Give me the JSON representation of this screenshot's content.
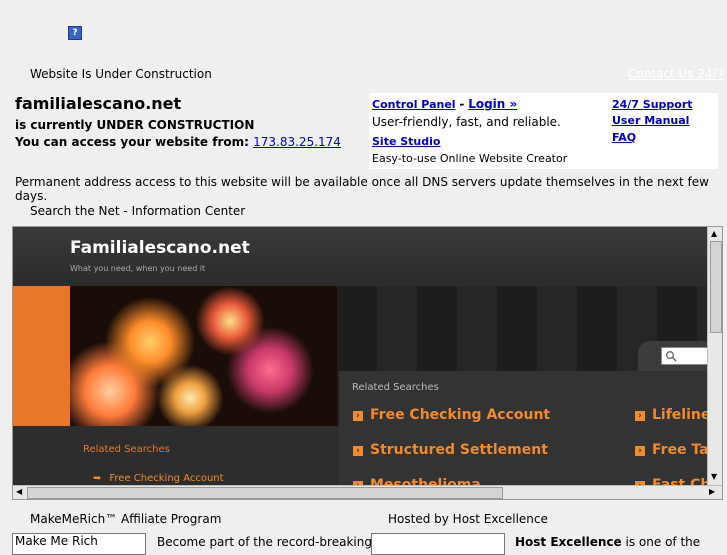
{
  "top": {
    "help_icon": "?",
    "under_construction": "Website Is Under Construction",
    "contact_link": "Contact Us 24/7"
  },
  "intro": {
    "domain": "familialescano.net",
    "line1": "is currently UNDER CONSTRUCTION",
    "line2_prefix": "You can access your website from:",
    "ip_link": "173.83.25.174"
  },
  "panel": {
    "control_panel": "Control Panel",
    "dash": "-",
    "login": "Login »",
    "tagline1": "User-friendly, fast, and reliable.",
    "site_studio": "Site Studio",
    "tagline2": "Easy-to-use Online Website Creator",
    "support": "24/7 Support",
    "manual": "User Manual",
    "faq": "FAQ"
  },
  "permanent_note": "Permanent address access to this website will be available once all DNS servers update themselves in the next few days.",
  "search_label": "Search the Net - Information Center",
  "frame": {
    "site_title": "Familialescano.net",
    "tagline": "What you need, when you need it",
    "related_header": "Related Searches",
    "related_items": [
      "Free Checking Account",
      "Structured Settlement",
      "Mesothelioma"
    ],
    "related_items_right": [
      "Lifeline",
      "Free Tax",
      "Fast Ch"
    ],
    "left_header": "Related Searches",
    "left_item": "Free Checking Account"
  },
  "footer": {
    "left_title": "MakeMeRich™ Affiliate Program",
    "right_title": "Hosted by Host Excellence",
    "box1": "Make Me Rich",
    "text1": "Become part of the record-breaking",
    "text2_bold": "Host Excellence",
    "text2_rest": " is one of the"
  },
  "colors": {
    "accent_orange": "#f28a2e",
    "link_blue": "#0000cc",
    "page_bg": "#efefef"
  }
}
